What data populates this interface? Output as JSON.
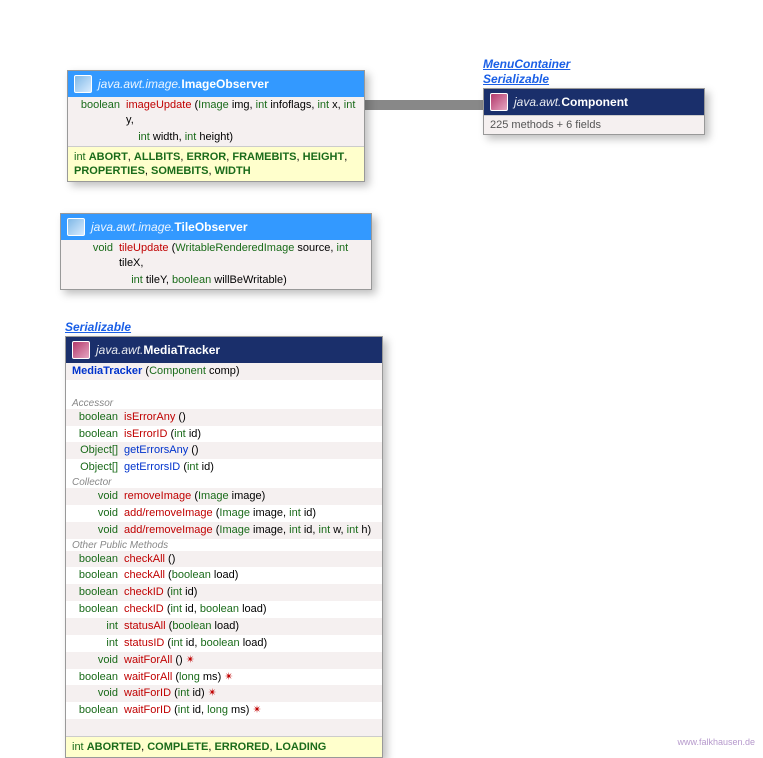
{
  "imageObserver": {
    "pkg": "java.awt.image.",
    "name": "ImageObserver",
    "method": {
      "ret": "boolean",
      "name": "imageUpdate",
      "params": [
        {
          "t": "Image",
          "n": "img"
        },
        {
          "t": "int",
          "n": "infoflags"
        },
        {
          "t": "int",
          "n": "x"
        },
        {
          "t": "int",
          "n": "y"
        },
        {
          "t": "int",
          "n": "width"
        },
        {
          "t": "int",
          "n": "height"
        }
      ]
    },
    "constsType": "int",
    "consts": [
      "ABORT",
      "ALLBITS",
      "ERROR",
      "FRAMEBITS",
      "HEIGHT",
      "PROPERTIES",
      "SOMEBITS",
      "WIDTH"
    ]
  },
  "tileObserver": {
    "pkg": "java.awt.image.",
    "name": "TileObserver",
    "method": {
      "ret": "void",
      "name": "tileUpdate",
      "params": [
        {
          "t": "WritableRenderedImage",
          "n": "source"
        },
        {
          "t": "int",
          "n": "tileX"
        },
        {
          "t": "int",
          "n": "tileY"
        },
        {
          "t": "boolean",
          "n": "willBeWritable"
        }
      ]
    }
  },
  "component": {
    "impl1": "MenuContainer",
    "impl2": "Serializable",
    "pkg": "java.awt.",
    "name": "Component",
    "summary": "225 methods + 6 fields"
  },
  "mediaTracker": {
    "impl": "Serializable",
    "pkg": "java.awt.",
    "name": "MediaTracker",
    "ctor": {
      "name": "MediaTracker",
      "params": [
        {
          "t": "Component",
          "n": "comp"
        }
      ]
    },
    "sections": {
      "accessor": "Accessor",
      "collector": "Collector",
      "other": "Other Public Methods"
    },
    "accessor": [
      {
        "ret": "boolean",
        "name": "isErrorAny",
        "params": []
      },
      {
        "ret": "boolean",
        "name": "isErrorID",
        "params": [
          {
            "t": "int",
            "n": "id"
          }
        ]
      },
      {
        "ret": "Object[]",
        "name": "getErrorsAny",
        "params": []
      },
      {
        "ret": "Object[]",
        "name": "getErrorsID",
        "params": [
          {
            "t": "int",
            "n": "id"
          }
        ]
      }
    ],
    "collector": [
      {
        "ret": "void",
        "name": "removeImage",
        "params": [
          {
            "t": "Image",
            "n": "image"
          }
        ]
      },
      {
        "ret": "void",
        "name": "add/removeImage",
        "params": [
          {
            "t": "Image",
            "n": "image"
          },
          {
            "t": "int",
            "n": "id"
          }
        ]
      },
      {
        "ret": "void",
        "name": "add/removeImage",
        "params": [
          {
            "t": "Image",
            "n": "image"
          },
          {
            "t": "int",
            "n": "id"
          },
          {
            "t": "int",
            "n": "w"
          },
          {
            "t": "int",
            "n": "h"
          }
        ]
      }
    ],
    "other": [
      {
        "ret": "boolean",
        "name": "checkAll",
        "params": []
      },
      {
        "ret": "boolean",
        "name": "checkAll",
        "params": [
          {
            "t": "boolean",
            "n": "load"
          }
        ]
      },
      {
        "ret": "boolean",
        "name": "checkID",
        "params": [
          {
            "t": "int",
            "n": "id"
          }
        ]
      },
      {
        "ret": "boolean",
        "name": "checkID",
        "params": [
          {
            "t": "int",
            "n": "id"
          },
          {
            "t": "boolean",
            "n": "load"
          }
        ]
      },
      {
        "ret": "int",
        "name": "statusAll",
        "params": [
          {
            "t": "boolean",
            "n": "load"
          }
        ]
      },
      {
        "ret": "int",
        "name": "statusID",
        "params": [
          {
            "t": "int",
            "n": "id"
          },
          {
            "t": "boolean",
            "n": "load"
          }
        ]
      },
      {
        "ret": "void",
        "name": "waitForAll",
        "params": [],
        "exc": "✴"
      },
      {
        "ret": "boolean",
        "name": "waitForAll",
        "params": [
          {
            "t": "long",
            "n": "ms"
          }
        ],
        "exc": "✴"
      },
      {
        "ret": "void",
        "name": "waitForID",
        "params": [
          {
            "t": "int",
            "n": "id"
          }
        ],
        "exc": "✴"
      },
      {
        "ret": "boolean",
        "name": "waitForID",
        "params": [
          {
            "t": "int",
            "n": "id"
          },
          {
            "t": "long",
            "n": "ms"
          }
        ],
        "exc": "✴"
      }
    ],
    "constsType": "int",
    "consts": [
      "ABORTED",
      "COMPLETE",
      "ERRORED",
      "LOADING"
    ]
  },
  "watermark": "www.falkhausen.de"
}
